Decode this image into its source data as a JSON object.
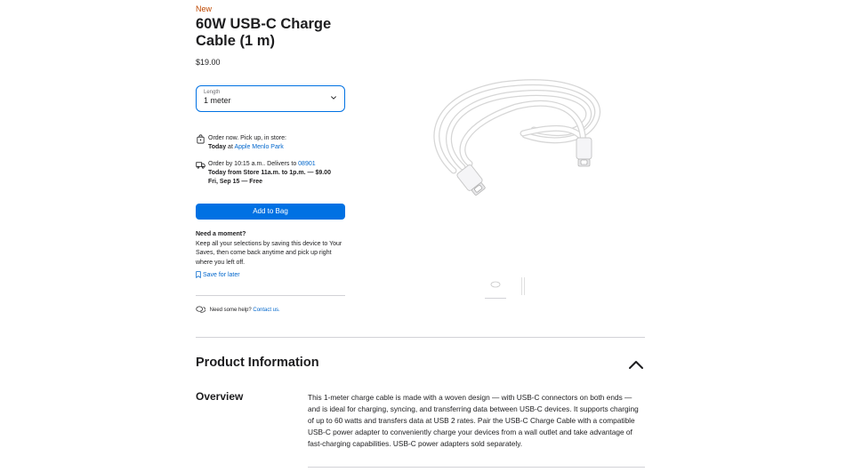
{
  "product": {
    "badge": "New",
    "title": "60W USB-C Charge Cable (1 m)",
    "price": "$19.00"
  },
  "length_select": {
    "label": "Length",
    "value": "1 meter"
  },
  "pickup": {
    "line1": "Order now. Pick up, in store:",
    "prefix": "Today",
    "at": " at ",
    "store": "Apple Menlo Park"
  },
  "delivery": {
    "line1": "Order by 10:15 a.m.. Delivers to ",
    "zip": "08901",
    "line2": "Today from Store 11a.m. to 1p.m. — $9.00",
    "line3": "Fri, Sep 15 — Free"
  },
  "add_to_bag": "Add to Bag",
  "moment": {
    "heading": "Need a moment?",
    "body": "Keep all your selections by saving this device to Your Saves, then come back anytime and pick up right where you left off.",
    "save_label": "Save for later"
  },
  "help": {
    "text": "Need some help? ",
    "link": "Contact us."
  },
  "product_info": {
    "title": "Product Information",
    "overview_title": "Overview",
    "overview_text": "This 1-meter charge cable is made with a woven design — with USB-C connectors on both ends — and is ideal for charging, syncing, and transferring data between USB-C devices. It supports charging of up to 60 watts and transfers data at USB 2 rates. Pair the USB-C Charge Cable with a compatible USB-C power adapter to conveniently charge your devices from a wall outlet and take advantage of fast-charging capabilities. USB-C power adapters sold separately."
  },
  "icons": [
    "store-icon",
    "truck-icon",
    "chevron-down-icon",
    "bookmark-icon",
    "chat-icon",
    "chevron-up-icon"
  ],
  "colors": {
    "accent": "#0071e3",
    "link": "#0066cc",
    "badge": "#bf4800"
  }
}
